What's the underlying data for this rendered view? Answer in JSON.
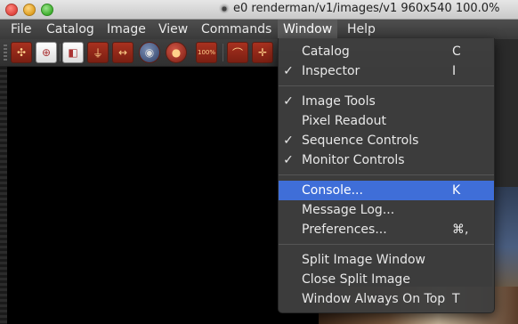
{
  "window": {
    "title": "e0 renderman/v1/images/v1 960x540 100.0%"
  },
  "menubar": {
    "items": [
      "File",
      "Catalog",
      "Image",
      "View",
      "Commands",
      "Window",
      "Help"
    ],
    "active": "Window"
  },
  "toolbar": {
    "buttons": [
      {
        "icon": "grid-crosshair-icon"
      },
      {
        "icon": "zoom-magnifier-icon"
      },
      {
        "icon": "frame-icon"
      },
      {
        "icon": "lamp-icon"
      },
      {
        "icon": "arrow-ruler-icon"
      },
      {
        "icon": "globe-hand-icon"
      },
      {
        "icon": "record-hand-icon"
      },
      {
        "icon": "zoom-100-icon",
        "label": "100%"
      },
      {
        "icon": "wave-icon"
      },
      {
        "icon": "crosshair-icon"
      }
    ]
  },
  "window_menu": {
    "items": [
      {
        "label": "Catalog",
        "shortcut": "C",
        "checked": false,
        "highlighted": false
      },
      {
        "label": "Inspector",
        "shortcut": "I",
        "checked": true,
        "highlighted": false
      },
      {
        "label": "Image Tools",
        "shortcut": "",
        "checked": true,
        "highlighted": false
      },
      {
        "label": "Pixel Readout",
        "shortcut": "",
        "checked": false,
        "highlighted": false
      },
      {
        "label": "Sequence Controls",
        "shortcut": "",
        "checked": true,
        "highlighted": false
      },
      {
        "label": "Monitor Controls",
        "shortcut": "",
        "checked": true,
        "highlighted": false
      },
      {
        "label": "Console...",
        "shortcut": "K",
        "checked": false,
        "highlighted": true
      },
      {
        "label": "Message Log...",
        "shortcut": "",
        "checked": false,
        "highlighted": false
      },
      {
        "label": "Preferences...",
        "shortcut": "⌘,",
        "checked": false,
        "highlighted": false
      },
      {
        "label": "Split Image Window",
        "shortcut": "",
        "checked": false,
        "highlighted": false
      },
      {
        "label": "Close Split Image",
        "shortcut": "",
        "checked": false,
        "highlighted": false
      },
      {
        "label": "Window Always On Top",
        "shortcut": "T",
        "checked": false,
        "highlighted": false
      }
    ],
    "check_glyph": "✓"
  },
  "colors": {
    "highlight": "#3f6ed8",
    "menubar": "#454545",
    "menu_bg": "#3e3e3e",
    "toolbar_button": "#a8311f"
  }
}
